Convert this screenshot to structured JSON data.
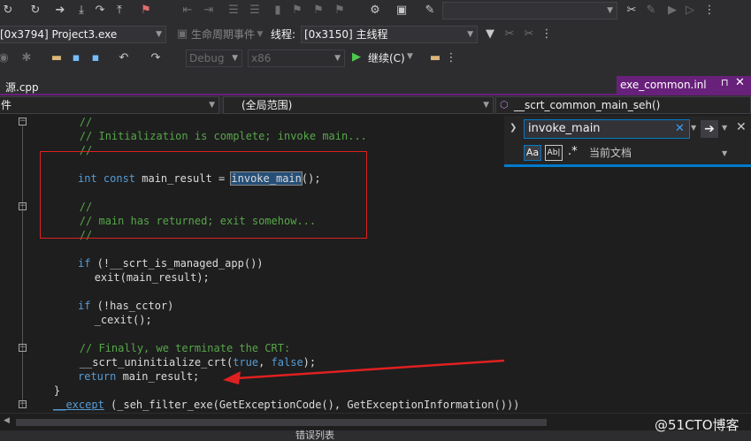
{
  "toolbar1": {
    "config_dropdown": ""
  },
  "toolbar2": {
    "process": "[0x3794] Project3.exe",
    "lifecycle": "生命周期事件",
    "thread_label": "线程:",
    "thread": "[0x3150] 主线程"
  },
  "toolbar3": {
    "config": "Debug",
    "platform": "x86",
    "continue": "继续(C)"
  },
  "tabs": {
    "left": "源.cpp",
    "right": "exe_common.inl"
  },
  "navbar": {
    "project": "件",
    "scope": "(全局范围)",
    "member": "__scrt_common_main_seh()"
  },
  "find": {
    "query": "invoke_main",
    "scope": "当前文档",
    "match_case": "Aa",
    "whole_word": "Ab|"
  },
  "code": {
    "l1": "        //",
    "l2": "        // Initialization is complete; invoke main...",
    "l3": "        //",
    "l5_kw": "int const",
    "l5_a": " main_result = ",
    "l5_hl": "invoke_main",
    "l5_b": "();",
    "l7": "        //",
    "l8": "        // main has returned; exit somehow...",
    "l9": "        //",
    "l11_kw": "if",
    "l11": " (!__scrt_is_managed_app())",
    "l12": "            exit(main_result);",
    "l14_kw": "if",
    "l14": " (!has_cctor)",
    "l15": "            _cexit();",
    "l17": "        // Finally, we terminate the CRT:",
    "l18_a": "        __scrt_uninitialize_crt(",
    "l18_t": "true",
    "l18_c": ", ",
    "l18_f": "false",
    "l18_e": ");",
    "l19_kw": "return",
    "l19": " main_result;",
    "l20": "    }",
    "l21_kw": "__except",
    "l21": " (_seh_filter_exe(GetExceptionCode(), GetExceptionInformation()))"
  },
  "bottom": {
    "errors_tab": "错误列表"
  },
  "watermark": "@51CTO博客",
  "colors": {
    "accent": "#68217a",
    "annotation": "#e02020",
    "comment": "#57a64a",
    "keyword": "#569cd6",
    "find_highlight": "#264f78"
  }
}
